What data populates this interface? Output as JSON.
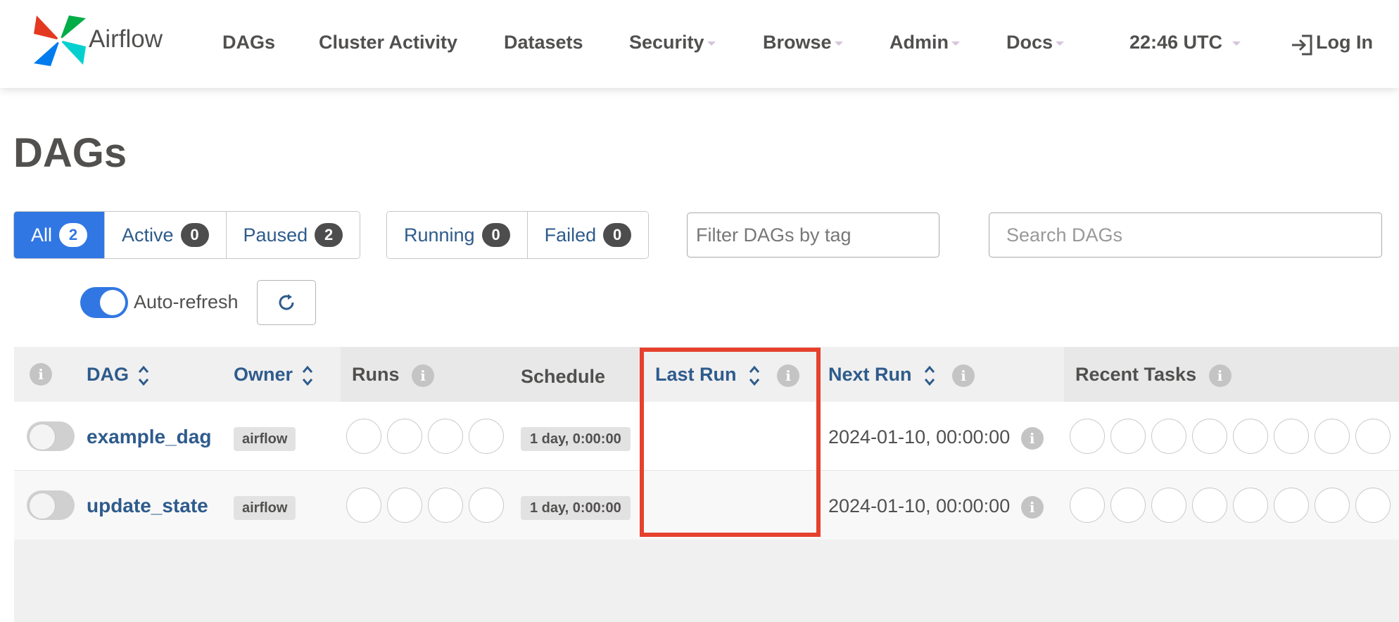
{
  "navbar": {
    "brand": "Airflow",
    "items": [
      {
        "label": "DAGs",
        "dropdown": false
      },
      {
        "label": "Cluster Activity",
        "dropdown": false
      },
      {
        "label": "Datasets",
        "dropdown": false
      },
      {
        "label": "Security",
        "dropdown": true
      },
      {
        "label": "Browse",
        "dropdown": true
      },
      {
        "label": "Admin",
        "dropdown": true
      },
      {
        "label": "Docs",
        "dropdown": true
      }
    ],
    "time": "22:46 UTC",
    "login": "Log In"
  },
  "page": {
    "title": "DAGs"
  },
  "filters": {
    "status": [
      {
        "label": "All",
        "count": "2",
        "active": true
      },
      {
        "label": "Active",
        "count": "0",
        "active": false
      },
      {
        "label": "Paused",
        "count": "2",
        "active": false
      }
    ],
    "runs": [
      {
        "label": "Running",
        "count": "0"
      },
      {
        "label": "Failed",
        "count": "0"
      }
    ],
    "tag_placeholder": "Filter DAGs by tag",
    "search_placeholder": "Search DAGs"
  },
  "auto_refresh": {
    "label": "Auto-refresh",
    "enabled": true
  },
  "table": {
    "headers": {
      "dag": "DAG",
      "owner": "Owner",
      "runs": "Runs",
      "schedule": "Schedule",
      "last_run": "Last Run",
      "next_run": "Next Run",
      "recent_tasks": "Recent Tasks"
    },
    "rows": [
      {
        "name": "example_dag",
        "owner": "airflow",
        "schedule": "1 day, 0:00:00",
        "last_run": "",
        "next_run": "2024-01-10, 00:00:00"
      },
      {
        "name": "update_state",
        "owner": "airflow",
        "schedule": "1 day, 0:00:00",
        "last_run": "",
        "next_run": "2024-01-10, 00:00:00"
      }
    ]
  },
  "colors": {
    "primary": "#3177e3",
    "link": "#2e5b8c",
    "highlight": "#e5412d"
  },
  "icons": {
    "info": "info-icon",
    "sort": "sort-icon",
    "refresh": "refresh-icon",
    "login": "login-icon"
  }
}
